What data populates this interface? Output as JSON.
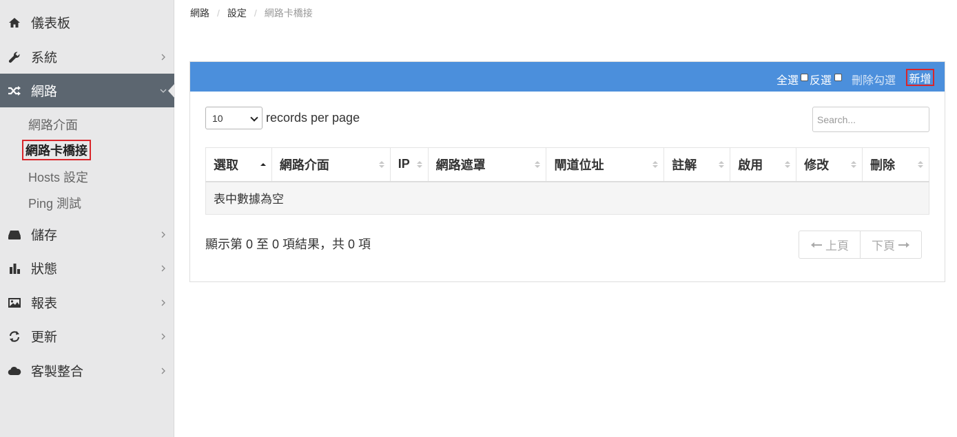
{
  "sidebar": {
    "items": [
      {
        "label": "儀表板",
        "icon": "home-icon"
      },
      {
        "label": "系統",
        "icon": "wrench-icon"
      },
      {
        "label": "網路",
        "icon": "shuffle-icon"
      },
      {
        "label": "儲存",
        "icon": "hdd-icon"
      },
      {
        "label": "狀態",
        "icon": "bar-chart-icon"
      },
      {
        "label": "報表",
        "icon": "image-icon"
      },
      {
        "label": "更新",
        "icon": "refresh-icon"
      },
      {
        "label": "客製整合",
        "icon": "cloud-icon"
      }
    ],
    "subitems": [
      {
        "label": "網路介面"
      },
      {
        "label": "網路卡橋接"
      },
      {
        "label": "Hosts 設定"
      },
      {
        "label": "Ping 測試"
      }
    ]
  },
  "breadcrumb": [
    "網路",
    "設定",
    "網路卡橋接"
  ],
  "panel_header": {
    "select_all": "全選",
    "invert": "反選",
    "delete_checked": "刪除勾選",
    "add": "新增"
  },
  "table_controls": {
    "page_length": "10",
    "records_label": "records per page",
    "search_placeholder": "Search..."
  },
  "table": {
    "columns": [
      "選取",
      "網路介面",
      "IP",
      "網路遮罩",
      "閘道位址",
      "註解",
      "啟用",
      "修改",
      "刪除"
    ],
    "empty_text": "表中數據為空"
  },
  "info_text": "顯示第 0 至 0 項結果，共 0 項",
  "pagination": {
    "prev": "上頁",
    "next": "下頁"
  },
  "colors": {
    "accent": "#4b8fdc",
    "sidebar_active": "#5c6670",
    "highlight_border": "#d9252a"
  }
}
